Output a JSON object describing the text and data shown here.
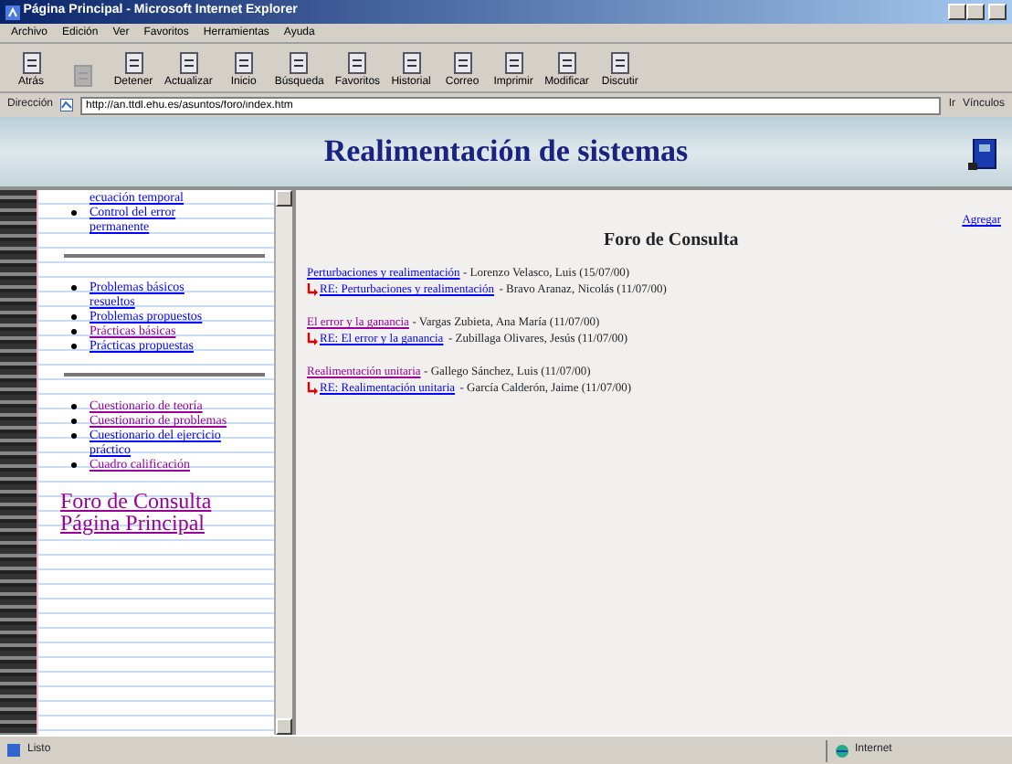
{
  "window": {
    "title": "Página Principal - Microsoft Internet Explorer"
  },
  "menu": [
    "Archivo",
    "Edición",
    "Ver",
    "Favoritos",
    "Herramientas",
    "Ayuda"
  ],
  "toolbar": [
    {
      "label": "Atrás",
      "disabled": false
    },
    {
      "disabled": true
    },
    {
      "label": "Detener",
      "disabled": false
    },
    {
      "label": "Actualizar",
      "disabled": false
    },
    {
      "label": "Inicio",
      "disabled": false
    },
    {
      "label": "Búsqueda",
      "disabled": false
    },
    {
      "label": "Favoritos",
      "disabled": false
    },
    {
      "label": "Historial",
      "disabled": false
    },
    {
      "label": "Correo",
      "disabled": false
    },
    {
      "label": "Imprimir",
      "disabled": false
    },
    {
      "label": "Modificar",
      "disabled": false
    },
    {
      "label": "Discutir",
      "disabled": false
    }
  ],
  "address": {
    "label": "Dirección",
    "value": "http://an.ttdl.ehu.es/asuntos/foro/index.htm",
    "go": "Ir",
    "links": "Vínculos"
  },
  "banner": {
    "title": "Realimentación de sistemas"
  },
  "sidebar": {
    "groups": [
      [
        {
          "text": "ecuación temporal",
          "bullet": false,
          "visited": false
        },
        {
          "text": "Control del error permanente",
          "bullet": true,
          "visited": false
        }
      ],
      [
        {
          "text": "Problemas básicos resueltos",
          "bullet": true,
          "visited": false
        },
        {
          "text": "Problemas propuestos",
          "bullet": true,
          "visited": false
        },
        {
          "text": "Prácticas básicas",
          "bullet": true,
          "visited": true
        },
        {
          "text": "Prácticas propuestas",
          "bullet": true,
          "visited": false
        }
      ],
      [
        {
          "text": "Cuestionario de teoría",
          "bullet": true,
          "visited": true
        },
        {
          "text": "Cuestionario de problemas",
          "bullet": true,
          "visited": true
        },
        {
          "text": "Cuestionario del ejercicio práctico",
          "bullet": true,
          "visited": false
        },
        {
          "text": "Cuadro calificación",
          "bullet": true,
          "visited": true
        }
      ]
    ],
    "big_links": [
      "Foro de Consulta",
      "Página Principal"
    ]
  },
  "forum": {
    "title": "Foro de Consulta",
    "add": "Agregar",
    "threads": [
      {
        "subject": "Perturbaciones y realimentación",
        "visited": false,
        "author": "- Lorenzo Velasco, Luis (15/07/00)",
        "replies": [
          {
            "subject": "RE: Perturbaciones y realimentación",
            "visited": false,
            "author": "- Bravo Aranaz, Nicolás (11/07/00)"
          }
        ]
      },
      {
        "subject": "El error y la ganancia",
        "visited": true,
        "author": "- Vargas Zubieta, Ana María (11/07/00)",
        "replies": [
          {
            "subject": "RE: El error y la ganancia",
            "visited": false,
            "author": "- Zubillaga Olivares, Jesús (11/07/00)"
          }
        ]
      },
      {
        "subject": "Realimentación unitaria",
        "visited": true,
        "author": "- Gallego Sánchez, Luis (11/07/00)",
        "replies": [
          {
            "subject": "RE: Realimentación unitaria",
            "visited": false,
            "author": "- García Calderón, Jaime (11/07/00)"
          }
        ]
      }
    ]
  },
  "status_bar": {
    "text": "Listo",
    "zone": "Internet"
  }
}
